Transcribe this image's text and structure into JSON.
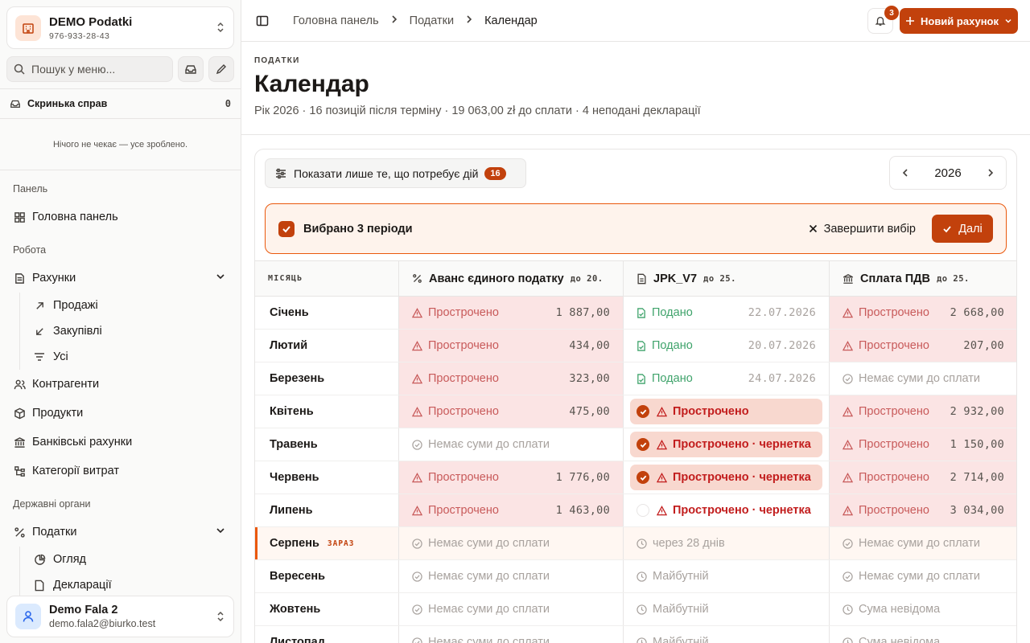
{
  "org": {
    "name": "DEMO Podatki",
    "phone": "976-933-28-43"
  },
  "sidebar": {
    "search_placeholder": "Пошук у меню...",
    "inbox": {
      "title": "Скринька справ",
      "count": "0",
      "empty": "Нічого не чекає — усе зроблено."
    },
    "sec_panel": "Панель",
    "dashboard": "Головна панель",
    "sec_work": "Робота",
    "invoices": "Рахунки",
    "sales": "Продажі",
    "purchases": "Закупівлі",
    "all": "Усі",
    "contractors": "Контрагенти",
    "products": "Продукти",
    "bank": "Банківські рахунки",
    "categories": "Категорії витрат",
    "sec_gov": "Державні органи",
    "taxes": "Податки",
    "overview": "Огляд",
    "declarations": "Декларації"
  },
  "user": {
    "name": "Demo Fala 2",
    "email": "demo.fala2@biurko.test"
  },
  "topbar": {
    "crumbs": [
      "Головна панель",
      "Податки",
      "Календар"
    ],
    "notif_count": "3",
    "new_invoice": "Новий рахунок"
  },
  "page": {
    "eyebrow": "ПОДАТКИ",
    "title": "Календар",
    "subtitle": "Рік 2026 · 16 позицій після терміну · 19 063,00 zł до сплати · 4 неподані декларації"
  },
  "toolbar": {
    "filter_label": "Показати лише те, що потребує дій",
    "filter_count": "16",
    "year": "2026"
  },
  "selection": {
    "text": "Вибрано 3 періоди",
    "finish": "Завершити вибір",
    "next": "Далі"
  },
  "table": {
    "headers": {
      "month": "МІСЯЦЬ",
      "c1": "Аванс єдиного податку",
      "c1_due": "до 20.",
      "c2": "JPK_V7",
      "c2_due": "до 25.",
      "c3": "Сплата ПДВ",
      "c3_due": "до 25."
    },
    "rows": [
      {
        "month": "Січень",
        "c1": {
          "kind": "over",
          "label": "Прострочено",
          "amount": "1 887,00"
        },
        "c2": {
          "kind": "filed",
          "label": "Подано",
          "amount": "22.07.2026"
        },
        "c3": {
          "kind": "over",
          "label": "Прострочено",
          "amount": "2 668,00"
        }
      },
      {
        "month": "Лютий",
        "c1": {
          "kind": "over",
          "label": "Прострочено",
          "amount": "434,00"
        },
        "c2": {
          "kind": "filed",
          "label": "Подано",
          "amount": "20.07.2026"
        },
        "c3": {
          "kind": "over",
          "label": "Прострочено",
          "amount": "207,00"
        }
      },
      {
        "month": "Березень",
        "c1": {
          "kind": "over",
          "label": "Прострочено",
          "amount": "323,00"
        },
        "c2": {
          "kind": "filed",
          "label": "Подано",
          "amount": "24.07.2026"
        },
        "c3": {
          "kind": "none",
          "label": "Немає суми до сплати",
          "amount": ""
        }
      },
      {
        "month": "Квітень",
        "c1": {
          "kind": "over",
          "label": "Прострочено",
          "amount": "475,00"
        },
        "c2": {
          "kind": "pill",
          "checked": true,
          "label": "Прострочено",
          "amount": ""
        },
        "c3": {
          "kind": "over",
          "label": "Прострочено",
          "amount": "2 932,00"
        }
      },
      {
        "month": "Травень",
        "c1": {
          "kind": "none",
          "label": "Немає суми до сплати",
          "amount": ""
        },
        "c2": {
          "kind": "pill",
          "checked": true,
          "label": "Прострочено · чернетка",
          "amount": ""
        },
        "c3": {
          "kind": "over",
          "label": "Прострочено",
          "amount": "1 150,00"
        }
      },
      {
        "month": "Червень",
        "c1": {
          "kind": "over",
          "label": "Прострочено",
          "amount": "1 776,00"
        },
        "c2": {
          "kind": "pill",
          "checked": true,
          "label": "Прострочено · чернетка",
          "amount": ""
        },
        "c3": {
          "kind": "over",
          "label": "Прострочено",
          "amount": "2 714,00"
        }
      },
      {
        "month": "Липень",
        "c1": {
          "kind": "over",
          "label": "Прострочено",
          "amount": "1 463,00"
        },
        "c2": {
          "kind": "pill",
          "checked": false,
          "label": "Прострочено · чернетка",
          "amount": ""
        },
        "c3": {
          "kind": "over",
          "label": "Прострочено",
          "amount": "3 034,00"
        }
      },
      {
        "month": "Серпень",
        "now": "ЗАРАЗ",
        "c1": {
          "kind": "none",
          "label": "Немає суми до сплати",
          "amount": ""
        },
        "c2": {
          "kind": "future",
          "label": "через 28 днів",
          "amount": ""
        },
        "c3": {
          "kind": "none",
          "label": "Немає суми до сплати",
          "amount": ""
        }
      },
      {
        "month": "Вересень",
        "c1": {
          "kind": "none",
          "label": "Немає суми до сплати",
          "amount": ""
        },
        "c2": {
          "kind": "future",
          "label": "Майбутній",
          "amount": ""
        },
        "c3": {
          "kind": "none",
          "label": "Немає суми до сплати",
          "amount": ""
        }
      },
      {
        "month": "Жовтень",
        "c1": {
          "kind": "none",
          "label": "Немає суми до сплати",
          "amount": ""
        },
        "c2": {
          "kind": "future",
          "label": "Майбутній",
          "amount": ""
        },
        "c3": {
          "kind": "future",
          "label": "Сума невідома",
          "amount": ""
        }
      },
      {
        "month": "Листопад",
        "c1": {
          "kind": "none",
          "label": "Немає суми до сплати",
          "amount": ""
        },
        "c2": {
          "kind": "future",
          "label": "Майбутній",
          "amount": ""
        },
        "c3": {
          "kind": "future",
          "label": "Сума невідома",
          "amount": ""
        }
      }
    ]
  },
  "colors": {
    "accent": "#c2410c",
    "overdue_bg": "#fbe4e4",
    "overdue_text": "#c85a5a",
    "filed": "#3fa36b"
  }
}
